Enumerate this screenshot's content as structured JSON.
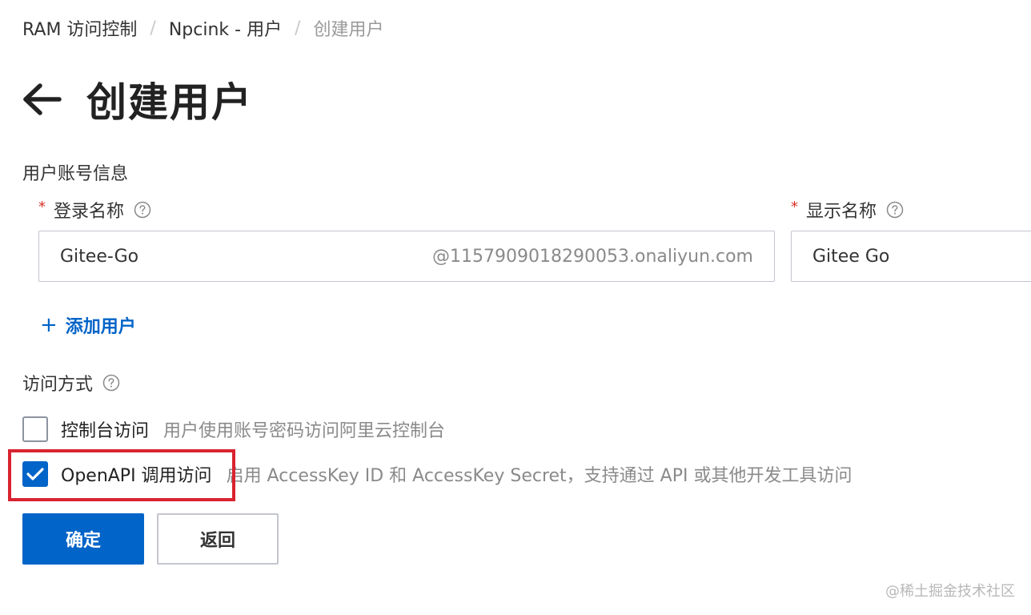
{
  "breadcrumb": {
    "items": [
      "RAM 访问控制",
      "Npcink - 用户",
      "创建用户"
    ],
    "separator": "/"
  },
  "page": {
    "title": "创建用户"
  },
  "user_info": {
    "section_label": "用户账号信息",
    "login_name": {
      "required_mark": "*",
      "label": "登录名称",
      "value": "Gitee-Go",
      "suffix": "@1157909018290053.onaliyun.com"
    },
    "display_name": {
      "required_mark": "*",
      "label": "显示名称",
      "value": "Gitee Go"
    },
    "add_user_label": "添加用户",
    "add_user_plus": "+"
  },
  "access": {
    "section_label": "访问方式",
    "options": [
      {
        "label": "控制台访问",
        "description": "用户使用账号密码访问阿里云控制台",
        "checked": false
      },
      {
        "label": "OpenAPI 调用访问",
        "description": "启用 AccessKey ID 和 AccessKey Secret，支持通过 API 或其他开发工具访问",
        "checked": true
      }
    ]
  },
  "buttons": {
    "confirm": "确定",
    "back": "返回"
  },
  "watermark": "@稀土掘金技术社区",
  "colors": {
    "primary": "#0064c8",
    "required": "#d93026",
    "highlight": "#d9232f"
  },
  "icons": [
    "arrow-left-icon",
    "help-icon",
    "plus-icon",
    "check-icon"
  ]
}
